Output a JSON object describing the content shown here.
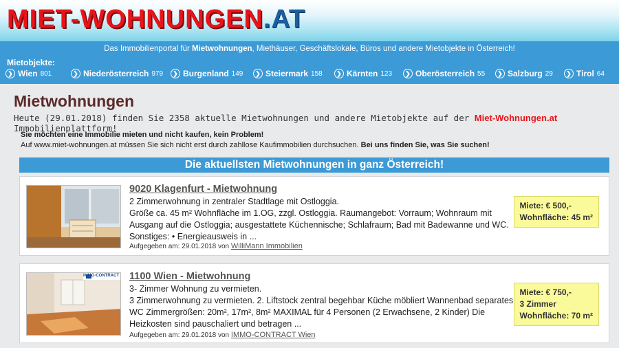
{
  "logo": {
    "main": "MIET-WOHNUNGEN",
    "tld": ".AT"
  },
  "topbar": {
    "tagline_pre": "Das Immobilienportal für ",
    "tagline_bold": "Mietwohnungen",
    "tagline_post": ", Miethäuser, Geschäftslokale, Büros und andere Mietobjekte in Österreich!",
    "mietobjekte_label": "Mietobjekte:",
    "regions": [
      {
        "name": "Wien",
        "count": "801"
      },
      {
        "name": "Niederösterreich",
        "count": "979"
      },
      {
        "name": "Burgenland",
        "count": "149"
      },
      {
        "name": "Steiermark",
        "count": "158"
      },
      {
        "name": "Kärnten",
        "count": "123"
      },
      {
        "name": "Oberösterreich",
        "count": "55"
      },
      {
        "name": "Salzburg",
        "count": "29"
      },
      {
        "name": "Tirol",
        "count": "64"
      }
    ]
  },
  "main": {
    "title": "Mietwohnungen",
    "intro_pre": "Heute (29.01.2018) finden Sie 2358 aktuelle Mietwohnungen und andere Mietobjekte auf der ",
    "intro_brand": "Miet-Wohnungen.at",
    "intro_post": " Immobilienplattform!",
    "para1": "Sie möchten eine Immobilie mieten und nicht kaufen, kein Problem!",
    "para2_pre": "Auf www.miet-wohnungen.at müssen Sie sich nicht erst durch zahllose Kaufimmobilien durchsuchen. ",
    "para2_bold": "Bei uns finden Sie, was Sie suchen!",
    "banner": "Die aktuellsten Mietwohnungen in ganz Österreich!"
  },
  "listings": [
    {
      "title": "9020 Klagenfurt - Mietwohnung",
      "subtitle": "2 Zimmerwohnung in zentraler Stadtlage mit Ostloggia.",
      "description": "Größe ca. 45 m² Wohnfläche im 1.OG, zzgl. Ostloggia. Raumangebot: Vorraum; Wohnraum mit Ausgang auf die Ostloggia; ausgestattete Küchennische; Schlafraum; Bad mit Badewanne und WC. Sonstiges: • Energieausweis in ...",
      "posted_label": "Aufgegeben am: 29.01.2018 von ",
      "agent": "WilliMann Immobilien",
      "price_lines": [
        "Miete: € 500,-",
        "Wohnfläche: 45 m²"
      ]
    },
    {
      "title": "1100 Wien - Mietwohnung",
      "subtitle": "3- Zimmer Wohnung zu vermieten.",
      "description": "3 Zimmerwohnung zu vermieten. 2. Liftstock zentral begehbar Küche möbliert Wannenbad separates WC Zimmergrößen: 20m², 17m², 8m² MAXIMAL für 4 Personen (2 Erwachsene, 2 Kinder) Die Heizkosten sind pauschaliert und betragen ...",
      "posted_label": "Aufgegeben am: 29.01.2018 von ",
      "agent": "IMMO-CONTRACT Wien",
      "price_lines": [
        "Miete: € 750,-",
        "3 Zimmer",
        "Wohnfläche: 70 m²"
      ],
      "image_badge": "IMMO-CONTRACT"
    }
  ]
}
